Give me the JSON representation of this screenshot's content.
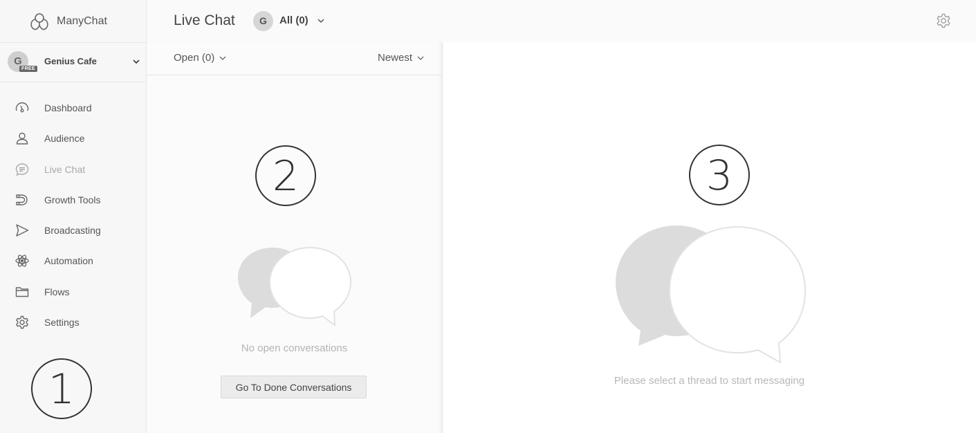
{
  "brand": {
    "name": "ManyChat",
    "icon": "manychat-logo-icon"
  },
  "account": {
    "avatar_letter": "G",
    "plan_badge": "FREE",
    "name": "Genius Cafe"
  },
  "sidebar": {
    "items": [
      {
        "label": "Dashboard",
        "icon": "speedometer-icon"
      },
      {
        "label": "Audience",
        "icon": "person-icon"
      },
      {
        "label": "Live Chat",
        "icon": "chat-icon",
        "active": true
      },
      {
        "label": "Growth Tools",
        "icon": "magnet-icon"
      },
      {
        "label": "Broadcasting",
        "icon": "send-icon"
      },
      {
        "label": "Automation",
        "icon": "atom-icon"
      },
      {
        "label": "Flows",
        "icon": "folder-icon"
      },
      {
        "label": "Settings",
        "icon": "gear-icon"
      }
    ]
  },
  "topbar": {
    "title": "Live Chat",
    "filter_avatar": "G",
    "filter_label": "All (0)"
  },
  "list": {
    "status_filter": "Open (0)",
    "sort_filter": "Newest",
    "empty_text": "No open conversations",
    "done_button": "Go To Done Conversations"
  },
  "message_pane": {
    "empty_text": "Please select a thread to start messaging"
  },
  "markers": [
    "1",
    "2",
    "3"
  ]
}
